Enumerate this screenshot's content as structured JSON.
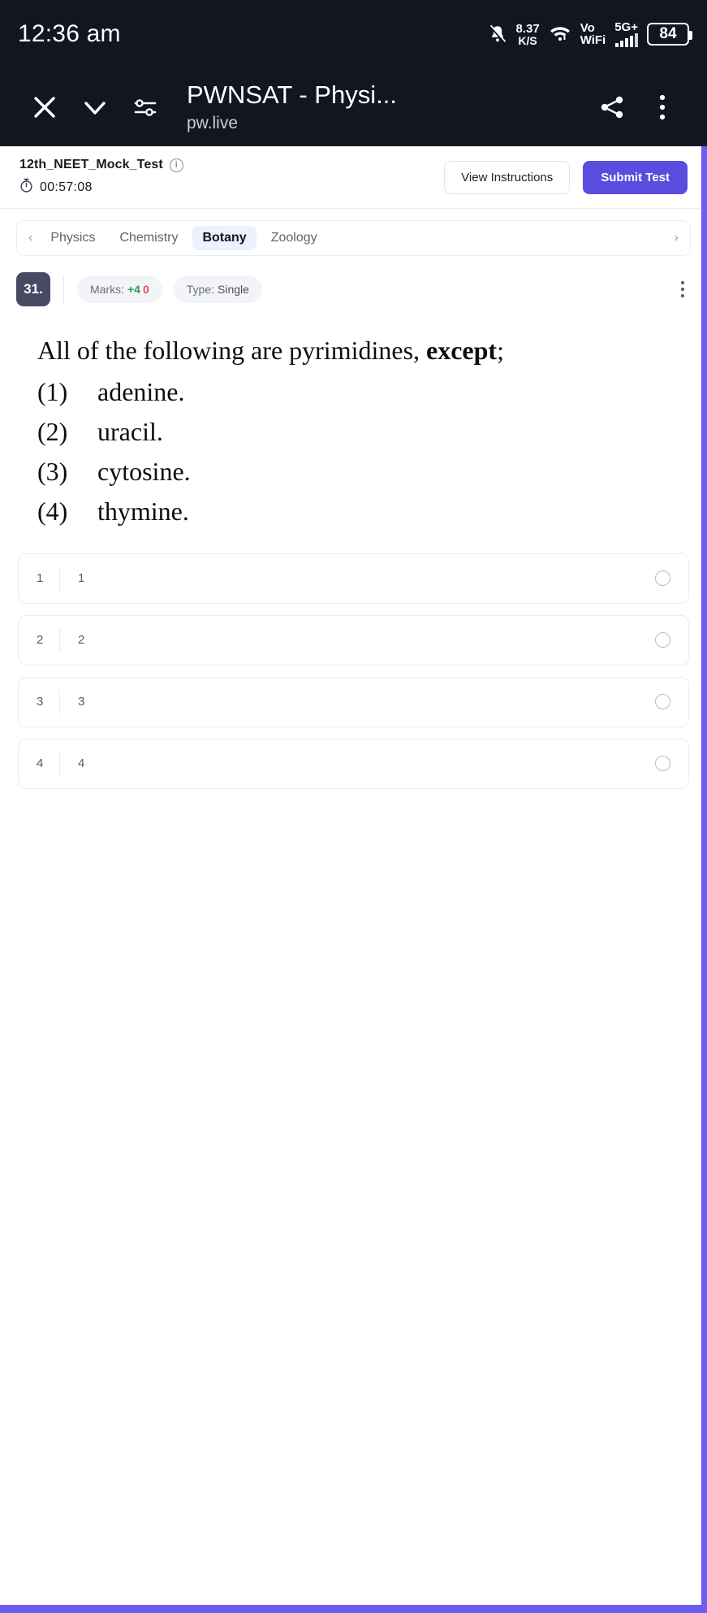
{
  "status_bar": {
    "time": "12:36 am",
    "net_speed_value": "8.37",
    "net_speed_unit": "K/S",
    "vo_line1": "Vo",
    "vo_line2": "WiFi",
    "network": "5G+",
    "battery": "84",
    "icons": [
      "bell-muted-icon",
      "wifi-icon",
      "signal-bars-icon",
      "battery-icon"
    ]
  },
  "browser_bar": {
    "title": "PWNSAT - Physi...",
    "url": "pw.live",
    "icons": [
      "close-icon",
      "chevron-down-icon",
      "page-settings-icon",
      "share-icon",
      "overflow-menu-icon"
    ]
  },
  "test_header": {
    "test_name": "12th_NEET_Mock_Test",
    "info_icon": "i",
    "timer": "00:57:08",
    "view_instructions_label": "View Instructions",
    "submit_label": "Submit Test"
  },
  "subject_tabs": {
    "prev_arrow": "‹",
    "next_arrow": "›",
    "items": [
      {
        "label": "Physics",
        "active": false
      },
      {
        "label": "Chemistry",
        "active": false
      },
      {
        "label": "Botany",
        "active": true
      },
      {
        "label": "Zoology",
        "active": false
      }
    ]
  },
  "question_meta": {
    "number": "31.",
    "marks_label": "Marks:",
    "marks_positive": "+4",
    "marks_negative": "0",
    "type_label": "Type:",
    "type_value": "Single"
  },
  "question": {
    "stem_prefix": "All of the following are pyrimidines, ",
    "stem_bold": "except",
    "stem_suffix": ";",
    "options": [
      {
        "num": "(1)",
        "text": "adenine."
      },
      {
        "num": "(2)",
        "text": "uracil."
      },
      {
        "num": "(3)",
        "text": "cytosine."
      },
      {
        "num": "(4)",
        "text": "thymine."
      }
    ]
  },
  "answer_options": [
    {
      "index": "1",
      "text": "1",
      "selected": false
    },
    {
      "index": "2",
      "text": "2",
      "selected": false
    },
    {
      "index": "3",
      "text": "3",
      "selected": false
    },
    {
      "index": "4",
      "text": "4",
      "selected": false
    }
  ],
  "colors": {
    "status_bg": "#131621",
    "primary": "#5b4ce0",
    "scrollbar": "#6d5df0",
    "badge": "#464a63",
    "positive": "#23a05a",
    "negative": "#e0535a",
    "tab_active_bg": "#edf0fd"
  }
}
